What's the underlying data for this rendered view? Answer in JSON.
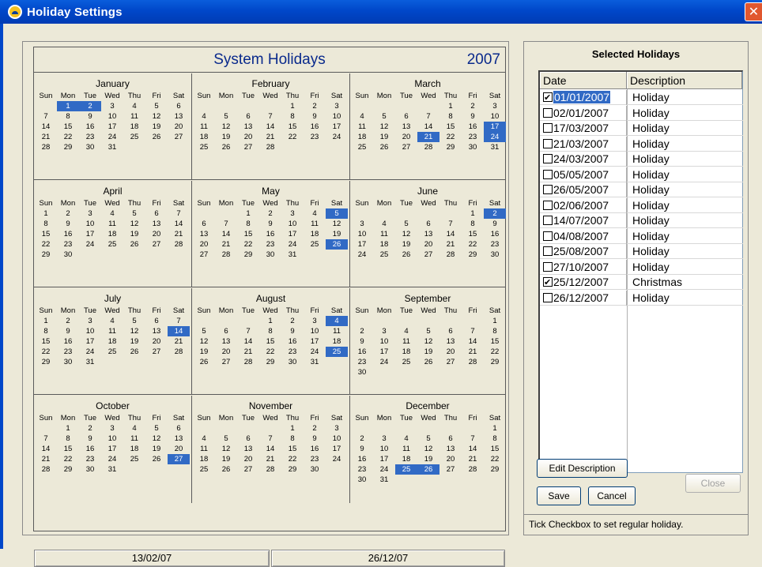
{
  "window": {
    "title": "Holiday Settings",
    "close": "✕"
  },
  "calendar": {
    "title": "System Holidays",
    "year": "2007",
    "weekdays": [
      "Sun",
      "Mon",
      "Tue",
      "Wed",
      "Thu",
      "Fri",
      "Sat"
    ],
    "months": [
      {
        "name": "January",
        "offset": 1,
        "days": 31,
        "selected": [
          1,
          2
        ]
      },
      {
        "name": "February",
        "offset": 4,
        "days": 28,
        "selected": []
      },
      {
        "name": "March",
        "offset": 4,
        "days": 31,
        "selected": [
          17,
          21,
          24
        ]
      },
      {
        "name": "April",
        "offset": 0,
        "days": 30,
        "selected": []
      },
      {
        "name": "May",
        "offset": 2,
        "days": 31,
        "selected": [
          5,
          26
        ]
      },
      {
        "name": "June",
        "offset": 5,
        "days": 30,
        "selected": [
          2
        ]
      },
      {
        "name": "July",
        "offset": 0,
        "days": 31,
        "selected": [
          14
        ]
      },
      {
        "name": "August",
        "offset": 3,
        "days": 31,
        "selected": [
          4,
          25
        ]
      },
      {
        "name": "September",
        "offset": 6,
        "days": 30,
        "selected": []
      },
      {
        "name": "October",
        "offset": 1,
        "days": 31,
        "selected": [
          27
        ]
      },
      {
        "name": "November",
        "offset": 4,
        "days": 30,
        "selected": []
      },
      {
        "name": "December",
        "offset": 6,
        "days": 31,
        "selected": [
          25,
          26
        ]
      }
    ],
    "footer_left": "13/02/07",
    "footer_right": "26/12/07"
  },
  "selected_holidays": {
    "title": "Selected Holidays",
    "columns": [
      "Date",
      "Description"
    ],
    "rows": [
      {
        "date": "01/01/2007",
        "desc": "Holiday",
        "checked": true,
        "highlight": true
      },
      {
        "date": "02/01/2007",
        "desc": "Holiday",
        "checked": false
      },
      {
        "date": "17/03/2007",
        "desc": "Holiday",
        "checked": false
      },
      {
        "date": "21/03/2007",
        "desc": "Holiday",
        "checked": false
      },
      {
        "date": "24/03/2007",
        "desc": "Holiday",
        "checked": false
      },
      {
        "date": "05/05/2007",
        "desc": "Holiday",
        "checked": false
      },
      {
        "date": "26/05/2007",
        "desc": "Holiday",
        "checked": false
      },
      {
        "date": "02/06/2007",
        "desc": "Holiday",
        "checked": false
      },
      {
        "date": "14/07/2007",
        "desc": "Holiday",
        "checked": false
      },
      {
        "date": "04/08/2007",
        "desc": "Holiday",
        "checked": false
      },
      {
        "date": "25/08/2007",
        "desc": "Holiday",
        "checked": false
      },
      {
        "date": "27/10/2007",
        "desc": "Holiday",
        "checked": false
      },
      {
        "date": "25/12/2007",
        "desc": "Christmas",
        "checked": true
      },
      {
        "date": "26/12/2007",
        "desc": "Holiday",
        "checked": false
      }
    ],
    "edit_button": "Edit Description",
    "save_button": "Save",
    "cancel_button": "Cancel",
    "close_button": "Close",
    "status": "Tick Checkbox to set regular holiday."
  }
}
